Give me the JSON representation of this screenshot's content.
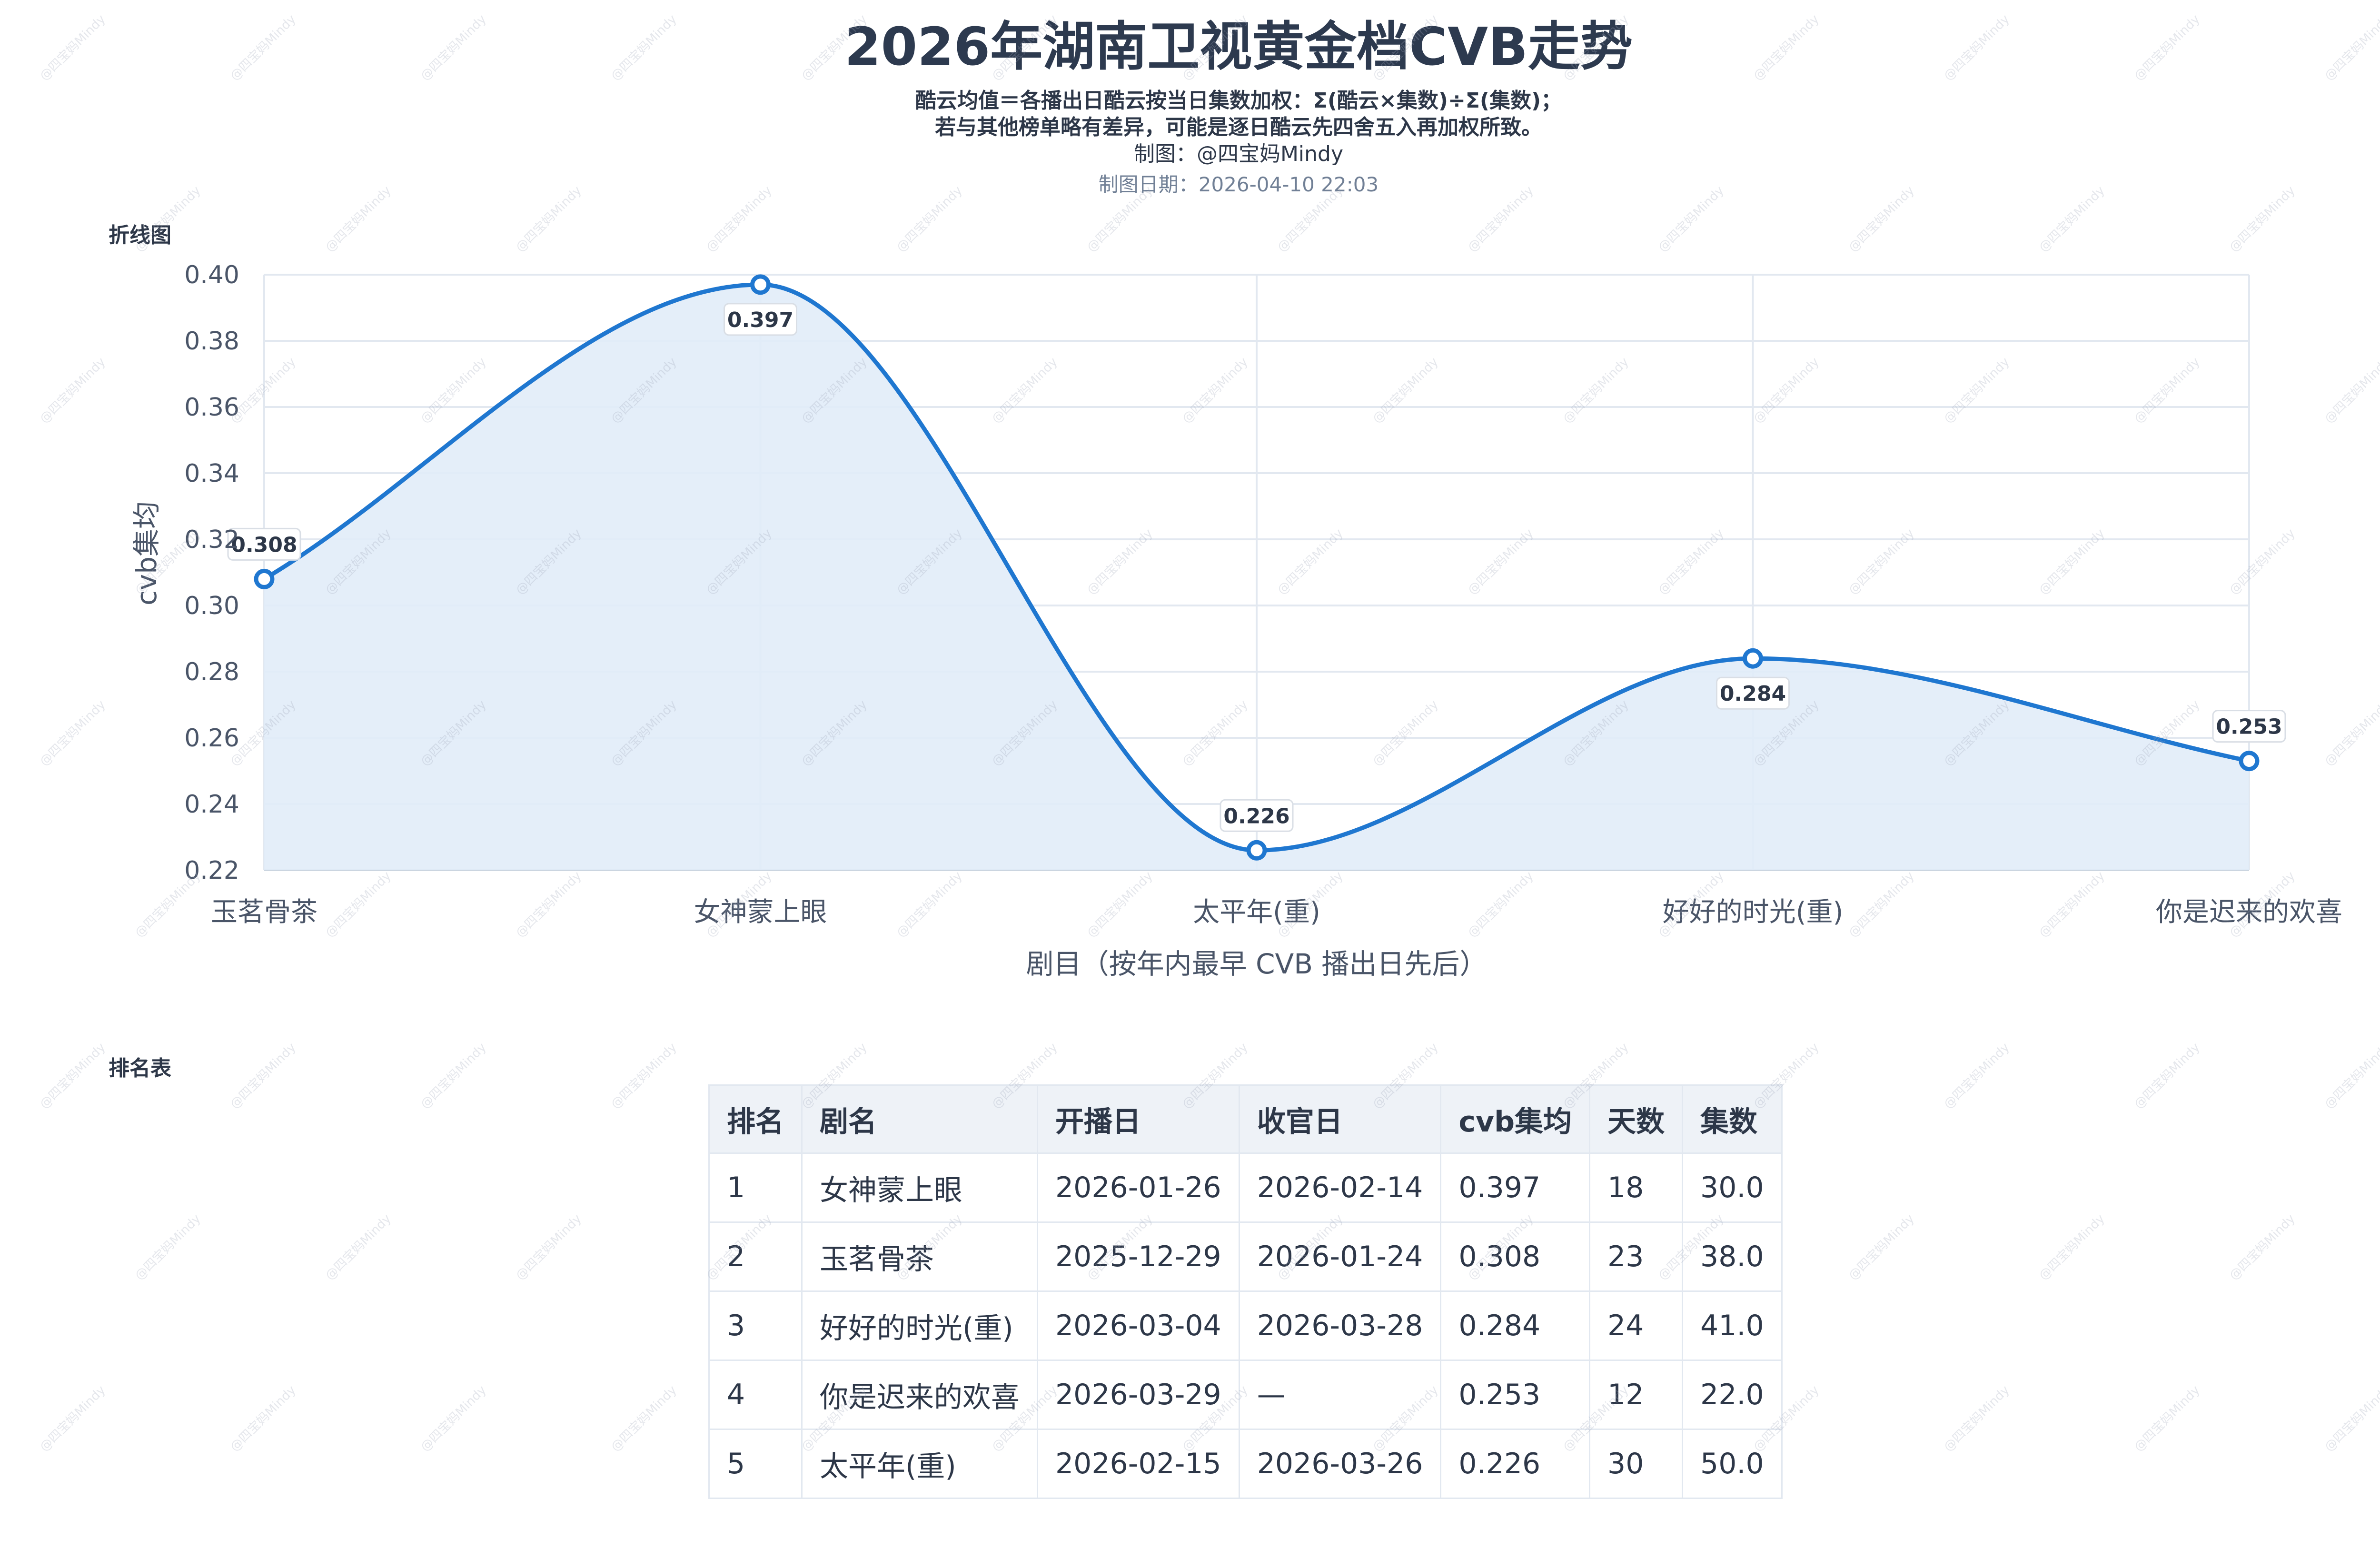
{
  "header": {
    "title": "2026年湖南卫视黄金档CVB走势",
    "subtitle_line1": "酷云均值＝各播出日酷云按当日集数加权：Σ(酷云×集数)÷Σ(集数)；",
    "subtitle_line2": "若与其他榜单略有差异，可能是逐日酷云先四舍五入再加权所致。",
    "author": "制图：@四宝妈Mindy",
    "date": "制图日期：2026-04-10 22:03"
  },
  "sections": {
    "chart_label": "折线图",
    "table_label": "排名表"
  },
  "watermark": "@四宝妈Mindy",
  "colors": {
    "line": "#1f77d0",
    "area": "#e1ecf8",
    "grid": "#e2e8f0"
  },
  "chart_data": {
    "type": "line",
    "smooth": true,
    "area_fill": true,
    "categories": [
      "玉茗骨茶",
      "女神蒙上眼",
      "太平年(重)",
      "好好的时光(重)",
      "你是迟来的欢喜"
    ],
    "values": [
      0.308,
      0.397,
      0.226,
      0.284,
      0.253
    ],
    "data_labels": [
      "0.308",
      "0.397",
      "0.226",
      "0.284",
      "0.253"
    ],
    "label_position": [
      "above",
      "below",
      "above",
      "below",
      "above"
    ],
    "xlabel": "剧目（按年内最早 CVB 播出日先后）",
    "ylabel": "cvb集均",
    "ylim": [
      0.22,
      0.4
    ],
    "yticks": [
      0.22,
      0.24,
      0.26,
      0.28,
      0.3,
      0.32,
      0.34,
      0.36,
      0.38,
      0.4
    ],
    "ytick_labels": [
      "0.22",
      "0.24",
      "0.26",
      "0.28",
      "0.30",
      "0.32",
      "0.34",
      "0.36",
      "0.38",
      "0.40"
    ],
    "grid": true
  },
  "table": {
    "headers": [
      "排名",
      "剧名",
      "开播日",
      "收官日",
      "cvb集均",
      "天数",
      "集数"
    ],
    "rows": [
      [
        "1",
        "女神蒙上眼",
        "2026-01-26",
        "2026-02-14",
        "0.397",
        "18",
        "30.0"
      ],
      [
        "2",
        "玉茗骨茶",
        "2025-12-29",
        "2026-01-24",
        "0.308",
        "23",
        "38.0"
      ],
      [
        "3",
        "好好的时光(重)",
        "2026-03-04",
        "2026-03-28",
        "0.284",
        "24",
        "41.0"
      ],
      [
        "4",
        "你是迟来的欢喜",
        "2026-03-29",
        "—",
        "0.253",
        "12",
        "22.0"
      ],
      [
        "5",
        "太平年(重)",
        "2026-02-15",
        "2026-03-26",
        "0.226",
        "30",
        "50.0"
      ]
    ]
  }
}
